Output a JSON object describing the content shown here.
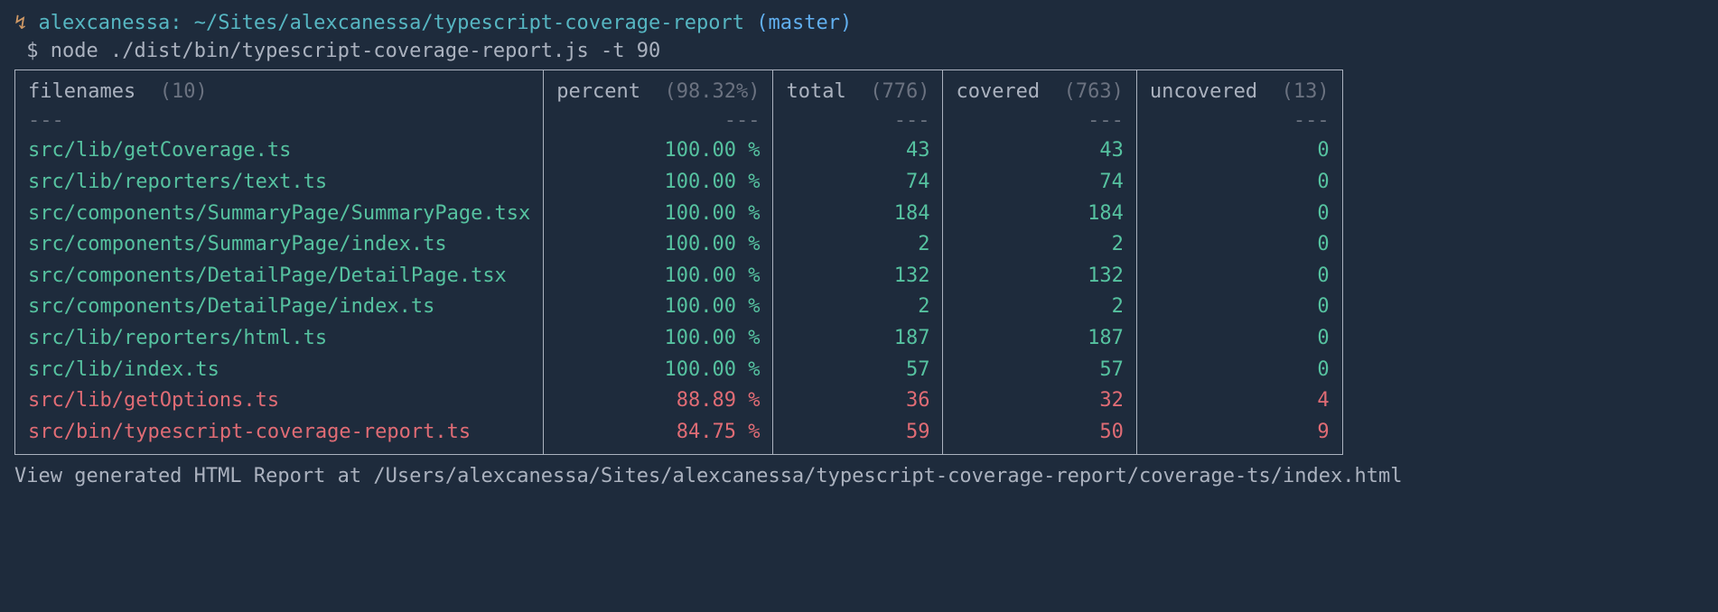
{
  "prompt": {
    "lightning": "↯",
    "user": "alexcanessa:",
    "path": "~/Sites/alexcanessa/typescript-coverage-report",
    "branch": "(master)",
    "dollar": "$",
    "command": "node ./dist/bin/typescript-coverage-report.js -t 90"
  },
  "headers": {
    "filenames_label": "filenames",
    "filenames_summary": "(10)",
    "percent_label": "percent",
    "percent_summary": "(98.32%)",
    "total_label": "total",
    "total_summary": "(776)",
    "covered_label": "covered",
    "covered_summary": "(763)",
    "uncovered_label": "uncovered",
    "uncovered_summary": "(13)"
  },
  "divider": "---",
  "rows": [
    {
      "file": "src/lib/getCoverage.ts",
      "percent": "100.00 %",
      "total": "43",
      "covered": "43",
      "uncovered": "0",
      "status": "good"
    },
    {
      "file": "src/lib/reporters/text.ts",
      "percent": "100.00 %",
      "total": "74",
      "covered": "74",
      "uncovered": "0",
      "status": "good"
    },
    {
      "file": "src/components/SummaryPage/SummaryPage.tsx",
      "percent": "100.00 %",
      "total": "184",
      "covered": "184",
      "uncovered": "0",
      "status": "good"
    },
    {
      "file": "src/components/SummaryPage/index.ts",
      "percent": "100.00 %",
      "total": "2",
      "covered": "2",
      "uncovered": "0",
      "status": "good"
    },
    {
      "file": "src/components/DetailPage/DetailPage.tsx",
      "percent": "100.00 %",
      "total": "132",
      "covered": "132",
      "uncovered": "0",
      "status": "good"
    },
    {
      "file": "src/components/DetailPage/index.ts",
      "percent": "100.00 %",
      "total": "2",
      "covered": "2",
      "uncovered": "0",
      "status": "good"
    },
    {
      "file": "src/lib/reporters/html.ts",
      "percent": "100.00 %",
      "total": "187",
      "covered": "187",
      "uncovered": "0",
      "status": "good"
    },
    {
      "file": "src/lib/index.ts",
      "percent": "100.00 %",
      "total": "57",
      "covered": "57",
      "uncovered": "0",
      "status": "good"
    },
    {
      "file": "src/lib/getOptions.ts",
      "percent": "88.89 %",
      "total": "36",
      "covered": "32",
      "uncovered": "4",
      "status": "bad"
    },
    {
      "file": "src/bin/typescript-coverage-report.ts",
      "percent": "84.75 %",
      "total": "59",
      "covered": "50",
      "uncovered": "9",
      "status": "bad"
    }
  ],
  "footer": "View generated HTML Report at /Users/alexcanessa/Sites/alexcanessa/typescript-coverage-report/coverage-ts/index.html"
}
